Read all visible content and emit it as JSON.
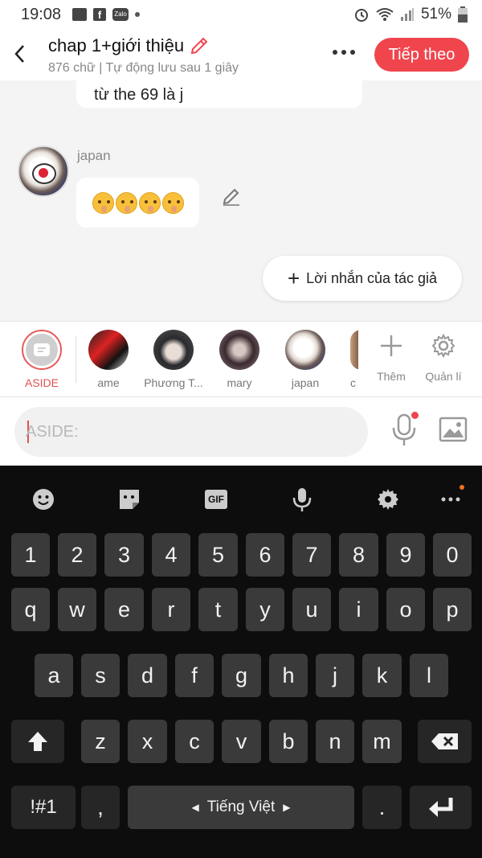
{
  "status": {
    "time": "19:08",
    "battery": "51%",
    "zalo": "Zalo"
  },
  "header": {
    "title": "chap 1+giới thiệu",
    "subtitle": "876 chữ | Tự động lưu sau 1 giây",
    "next_label": "Tiếp theo",
    "accent": "#f0454d"
  },
  "chat": {
    "prev_message": "từ the 69 là j",
    "sender": "japan",
    "emoji_message": "🤫🤫🤫🤫",
    "author_note_label": "Lời nhắn của tác giả"
  },
  "characters": [
    {
      "label": "ASIDE",
      "selected": true
    },
    {
      "label": "ame"
    },
    {
      "label": "Phương T..."
    },
    {
      "label": "mary"
    },
    {
      "label": "japan"
    },
    {
      "label": "c"
    }
  ],
  "tools": {
    "add_label": "Thêm",
    "manage_label": "Quản lí"
  },
  "input": {
    "placeholder": "ASIDE:"
  },
  "keyboard": {
    "tool_gif": "GIF",
    "row_numbers": [
      "1",
      "2",
      "3",
      "4",
      "5",
      "6",
      "7",
      "8",
      "9",
      "0"
    ],
    "row1": [
      "q",
      "w",
      "e",
      "r",
      "t",
      "y",
      "u",
      "i",
      "o",
      "p"
    ],
    "row2": [
      "a",
      "s",
      "d",
      "f",
      "g",
      "h",
      "j",
      "k",
      "l"
    ],
    "row3": [
      "z",
      "x",
      "c",
      "v",
      "b",
      "n",
      "m"
    ],
    "sym_label": "!#1",
    "comma": ",",
    "space_label": "Tiếng Việt",
    "period": "."
  }
}
